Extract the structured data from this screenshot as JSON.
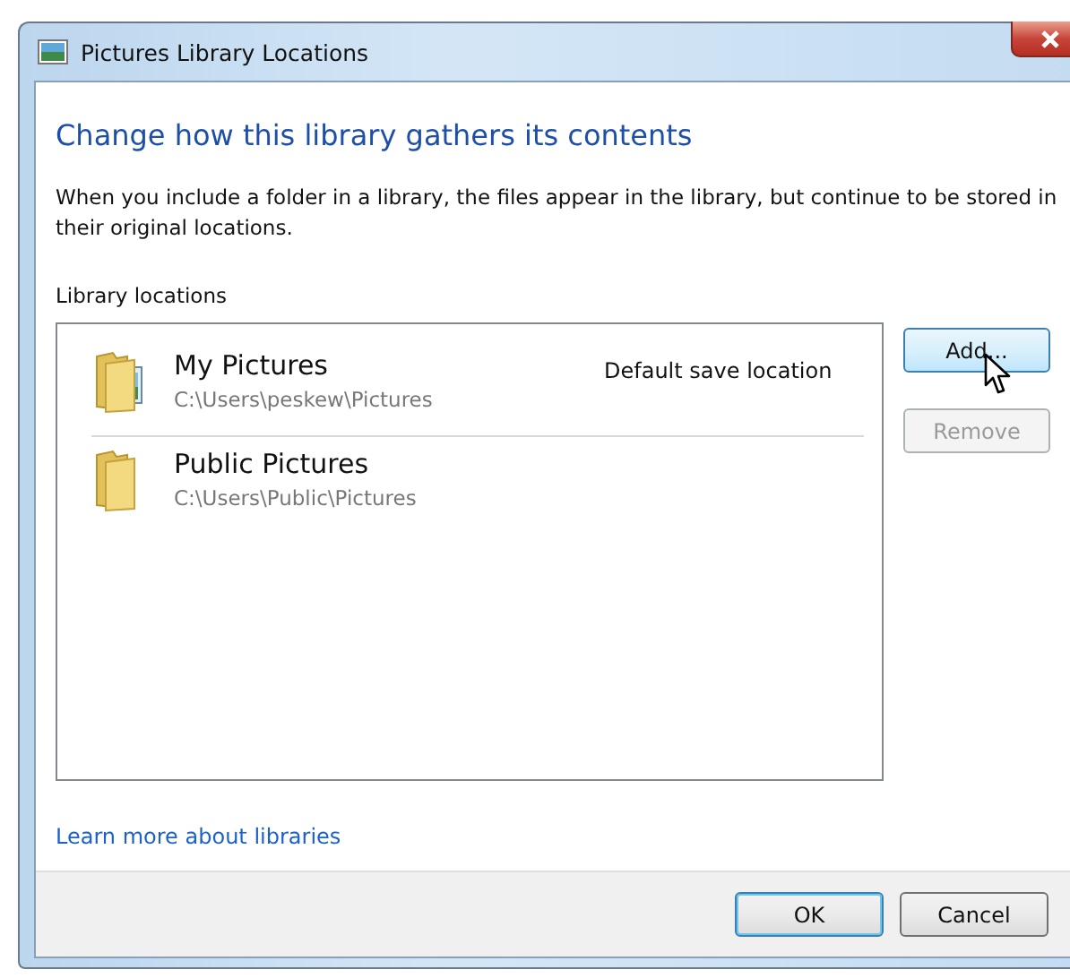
{
  "window": {
    "title": "Pictures Library Locations"
  },
  "heading": "Change how this library gathers its contents",
  "description": "When you include a folder in a library, the files appear in the library, but continue to be stored in their original locations.",
  "locations_label": "Library locations",
  "locations": [
    {
      "name": "My Pictures",
      "path": "C:\\Users\\peskew\\Pictures",
      "note": "Default save location",
      "kind": "pictures"
    },
    {
      "name": "Public Pictures",
      "path": "C:\\Users\\Public\\Pictures",
      "kind": "plain"
    }
  ],
  "side_buttons": [
    {
      "label": "Add...",
      "hovered": true,
      "disabled": false
    },
    {
      "label": "Remove",
      "hovered": false,
      "disabled": true
    }
  ],
  "link": "Learn more about libraries",
  "footer_buttons": [
    {
      "label": "OK",
      "default": true
    },
    {
      "label": "Cancel",
      "default": false
    }
  ]
}
